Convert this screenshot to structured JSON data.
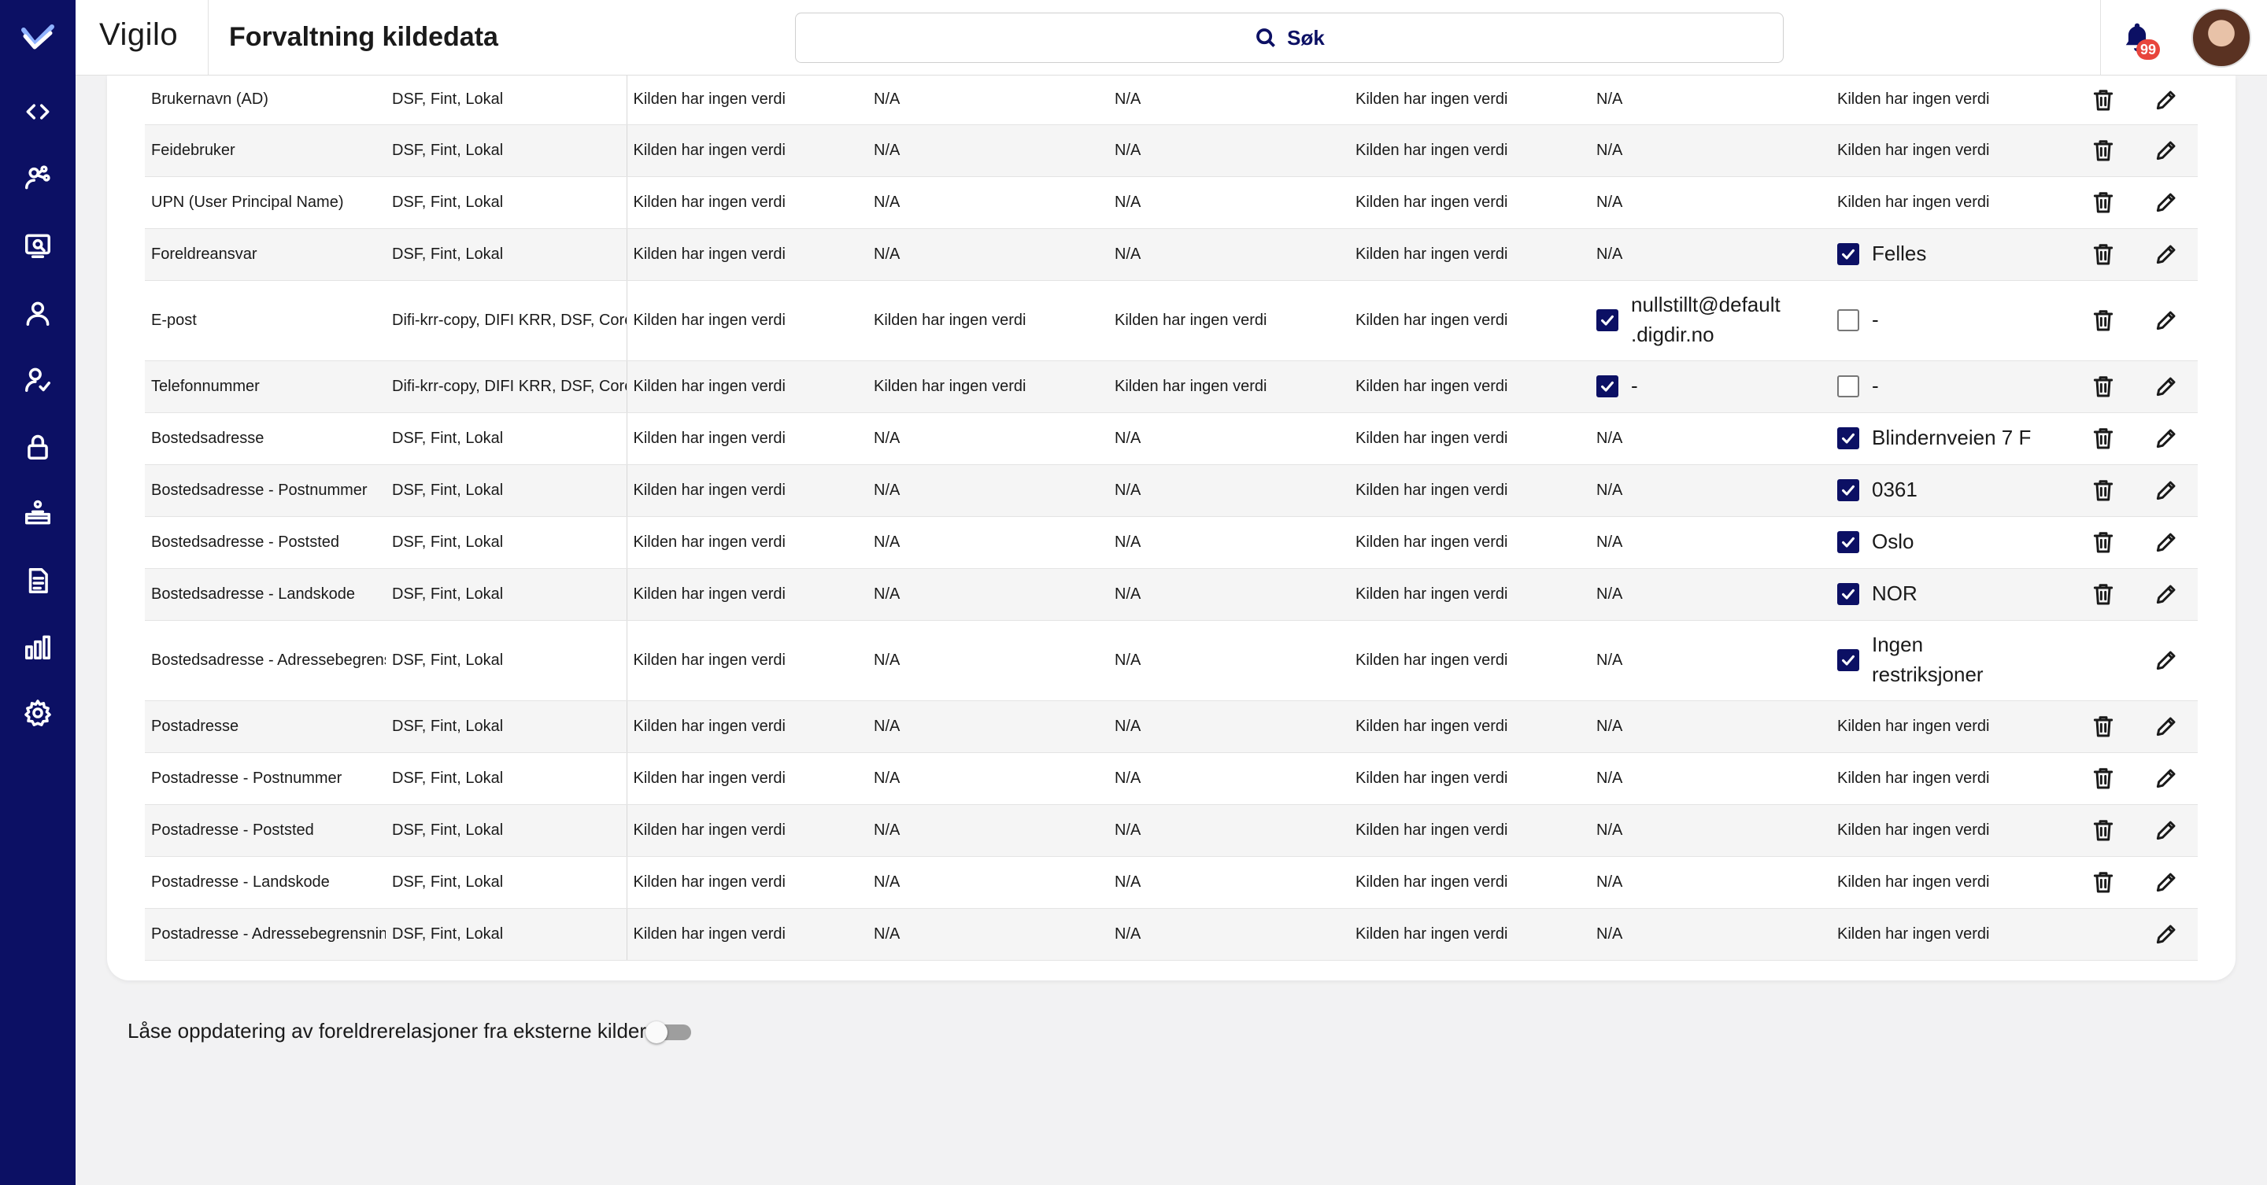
{
  "app": {
    "brand": "Vigilo",
    "page_title": "Forvaltning kildedata"
  },
  "search": {
    "label": "Søk"
  },
  "notifications": {
    "count": "99"
  },
  "sidebar": {
    "items": [
      {
        "icon": "code-icon"
      },
      {
        "icon": "users-network-icon"
      },
      {
        "icon": "dashboard-search-icon"
      },
      {
        "icon": "user-icon"
      },
      {
        "icon": "user-check-icon"
      },
      {
        "icon": "lock-icon"
      },
      {
        "icon": "classroom-icon"
      },
      {
        "icon": "document-icon"
      },
      {
        "icon": "bar-chart-icon"
      },
      {
        "icon": "gear-icon"
      }
    ]
  },
  "table": {
    "rows": [
      {
        "name": "Brukernavn (AD)",
        "sources": "DSF, Fint, Lokal",
        "c3": "Kilden har ingen verdi",
        "c4": "N/A",
        "c5": "N/A",
        "c6": "Kilden har ingen verdi",
        "c7": {
          "text": "N/A"
        },
        "c8": {
          "text": "Kilden har ingen verdi"
        },
        "delete": true
      },
      {
        "name": "Feidebruker",
        "sources": "DSF, Fint, Lokal",
        "c3": "Kilden har ingen verdi",
        "c4": "N/A",
        "c5": "N/A",
        "c6": "Kilden har ingen verdi",
        "c7": {
          "text": "N/A"
        },
        "c8": {
          "text": "Kilden har ingen verdi"
        },
        "delete": true
      },
      {
        "name": "UPN (User Principal Name)",
        "sources": "DSF, Fint, Lokal",
        "c3": "Kilden har ingen verdi",
        "c4": "N/A",
        "c5": "N/A",
        "c6": "Kilden har ingen verdi",
        "c7": {
          "text": "N/A"
        },
        "c8": {
          "text": "Kilden har ingen verdi"
        },
        "delete": true
      },
      {
        "name": "Foreldreansvar",
        "sources": "DSF, Fint, Lokal",
        "c3": "Kilden har ingen verdi",
        "c4": "N/A",
        "c5": "N/A",
        "c6": "Kilden har ingen verdi",
        "c7": {
          "text": "N/A"
        },
        "c8": {
          "checkbox": true,
          "checked": true,
          "text": "Felles"
        },
        "delete": true
      },
      {
        "name": "E-post",
        "sources": "Difi-krr-copy, DIFI KRR, DSF, Core-a",
        "c3": "Kilden har ingen verdi",
        "c4": "Kilden har ingen verdi",
        "c5": "Kilden har ingen verdi",
        "c6": "Kilden har ingen verdi",
        "c7": {
          "checkbox": true,
          "checked": true,
          "text": "nullstillt@default\n.digdir.no"
        },
        "c8": {
          "checkbox": true,
          "checked": false,
          "text": "-"
        },
        "delete": true
      },
      {
        "name": "Telefonnummer",
        "sources": "Difi-krr-copy, DIFI KRR, DSF, Core-a",
        "c3": "Kilden har ingen verdi",
        "c4": "Kilden har ingen verdi",
        "c5": "Kilden har ingen verdi",
        "c6": "Kilden har ingen verdi",
        "c7": {
          "checkbox": true,
          "checked": true,
          "text": "-"
        },
        "c8": {
          "checkbox": true,
          "checked": false,
          "text": "-"
        },
        "delete": true
      },
      {
        "name": "Bostedsadresse",
        "sources": "DSF, Fint, Lokal",
        "c3": "Kilden har ingen verdi",
        "c4": "N/A",
        "c5": "N/A",
        "c6": "Kilden har ingen verdi",
        "c7": {
          "text": "N/A"
        },
        "c8": {
          "checkbox": true,
          "checked": true,
          "text": "Blindernveien 7 F"
        },
        "delete": true
      },
      {
        "name": "Bostedsadresse - Postnummer",
        "sources": "DSF, Fint, Lokal",
        "c3": "Kilden har ingen verdi",
        "c4": "N/A",
        "c5": "N/A",
        "c6": "Kilden har ingen verdi",
        "c7": {
          "text": "N/A"
        },
        "c8": {
          "checkbox": true,
          "checked": true,
          "text": "0361"
        },
        "delete": true
      },
      {
        "name": "Bostedsadresse - Poststed",
        "sources": "DSF, Fint, Lokal",
        "c3": "Kilden har ingen verdi",
        "c4": "N/A",
        "c5": "N/A",
        "c6": "Kilden har ingen verdi",
        "c7": {
          "text": "N/A"
        },
        "c8": {
          "checkbox": true,
          "checked": true,
          "text": "Oslo"
        },
        "delete": true
      },
      {
        "name": "Bostedsadresse - Landskode",
        "sources": "DSF, Fint, Lokal",
        "c3": "Kilden har ingen verdi",
        "c4": "N/A",
        "c5": "N/A",
        "c6": "Kilden har ingen verdi",
        "c7": {
          "text": "N/A"
        },
        "c8": {
          "checkbox": true,
          "checked": true,
          "text": "NOR"
        },
        "delete": true
      },
      {
        "name": "Bostedsadresse - Adressebegrensni",
        "sources": "DSF, Fint, Lokal",
        "c3": "Kilden har ingen verdi",
        "c4": "N/A",
        "c5": "N/A",
        "c6": "Kilden har ingen verdi",
        "c7": {
          "text": "N/A"
        },
        "c8": {
          "checkbox": true,
          "checked": true,
          "text": "Ingen\nrestriksjoner"
        },
        "delete": false
      },
      {
        "name": "Postadresse",
        "sources": "DSF, Fint, Lokal",
        "c3": "Kilden har ingen verdi",
        "c4": "N/A",
        "c5": "N/A",
        "c6": "Kilden har ingen verdi",
        "c7": {
          "text": "N/A"
        },
        "c8": {
          "text": "Kilden har ingen verdi"
        },
        "delete": true
      },
      {
        "name": "Postadresse - Postnummer",
        "sources": "DSF, Fint, Lokal",
        "c3": "Kilden har ingen verdi",
        "c4": "N/A",
        "c5": "N/A",
        "c6": "Kilden har ingen verdi",
        "c7": {
          "text": "N/A"
        },
        "c8": {
          "text": "Kilden har ingen verdi"
        },
        "delete": true
      },
      {
        "name": "Postadresse - Poststed",
        "sources": "DSF, Fint, Lokal",
        "c3": "Kilden har ingen verdi",
        "c4": "N/A",
        "c5": "N/A",
        "c6": "Kilden har ingen verdi",
        "c7": {
          "text": "N/A"
        },
        "c8": {
          "text": "Kilden har ingen verdi"
        },
        "delete": true
      },
      {
        "name": "Postadresse - Landskode",
        "sources": "DSF, Fint, Lokal",
        "c3": "Kilden har ingen verdi",
        "c4": "N/A",
        "c5": "N/A",
        "c6": "Kilden har ingen verdi",
        "c7": {
          "text": "N/A"
        },
        "c8": {
          "text": "Kilden har ingen verdi"
        },
        "delete": true
      },
      {
        "name": "Postadresse - Adressebegrensning",
        "sources": "DSF, Fint, Lokal",
        "c3": "Kilden har ingen verdi",
        "c4": "N/A",
        "c5": "N/A",
        "c6": "Kilden har ingen verdi",
        "c7": {
          "text": "N/A"
        },
        "c8": {
          "text": "Kilden har ingen verdi"
        },
        "delete": false
      }
    ]
  },
  "footer": {
    "lock_label": "Låse oppdatering av foreldrerelasjoner fra eksterne kilder",
    "lock_enabled": false
  },
  "colors": {
    "primary": "#0c1064",
    "badge": "#e8453c",
    "background": "#f2f2f3"
  }
}
